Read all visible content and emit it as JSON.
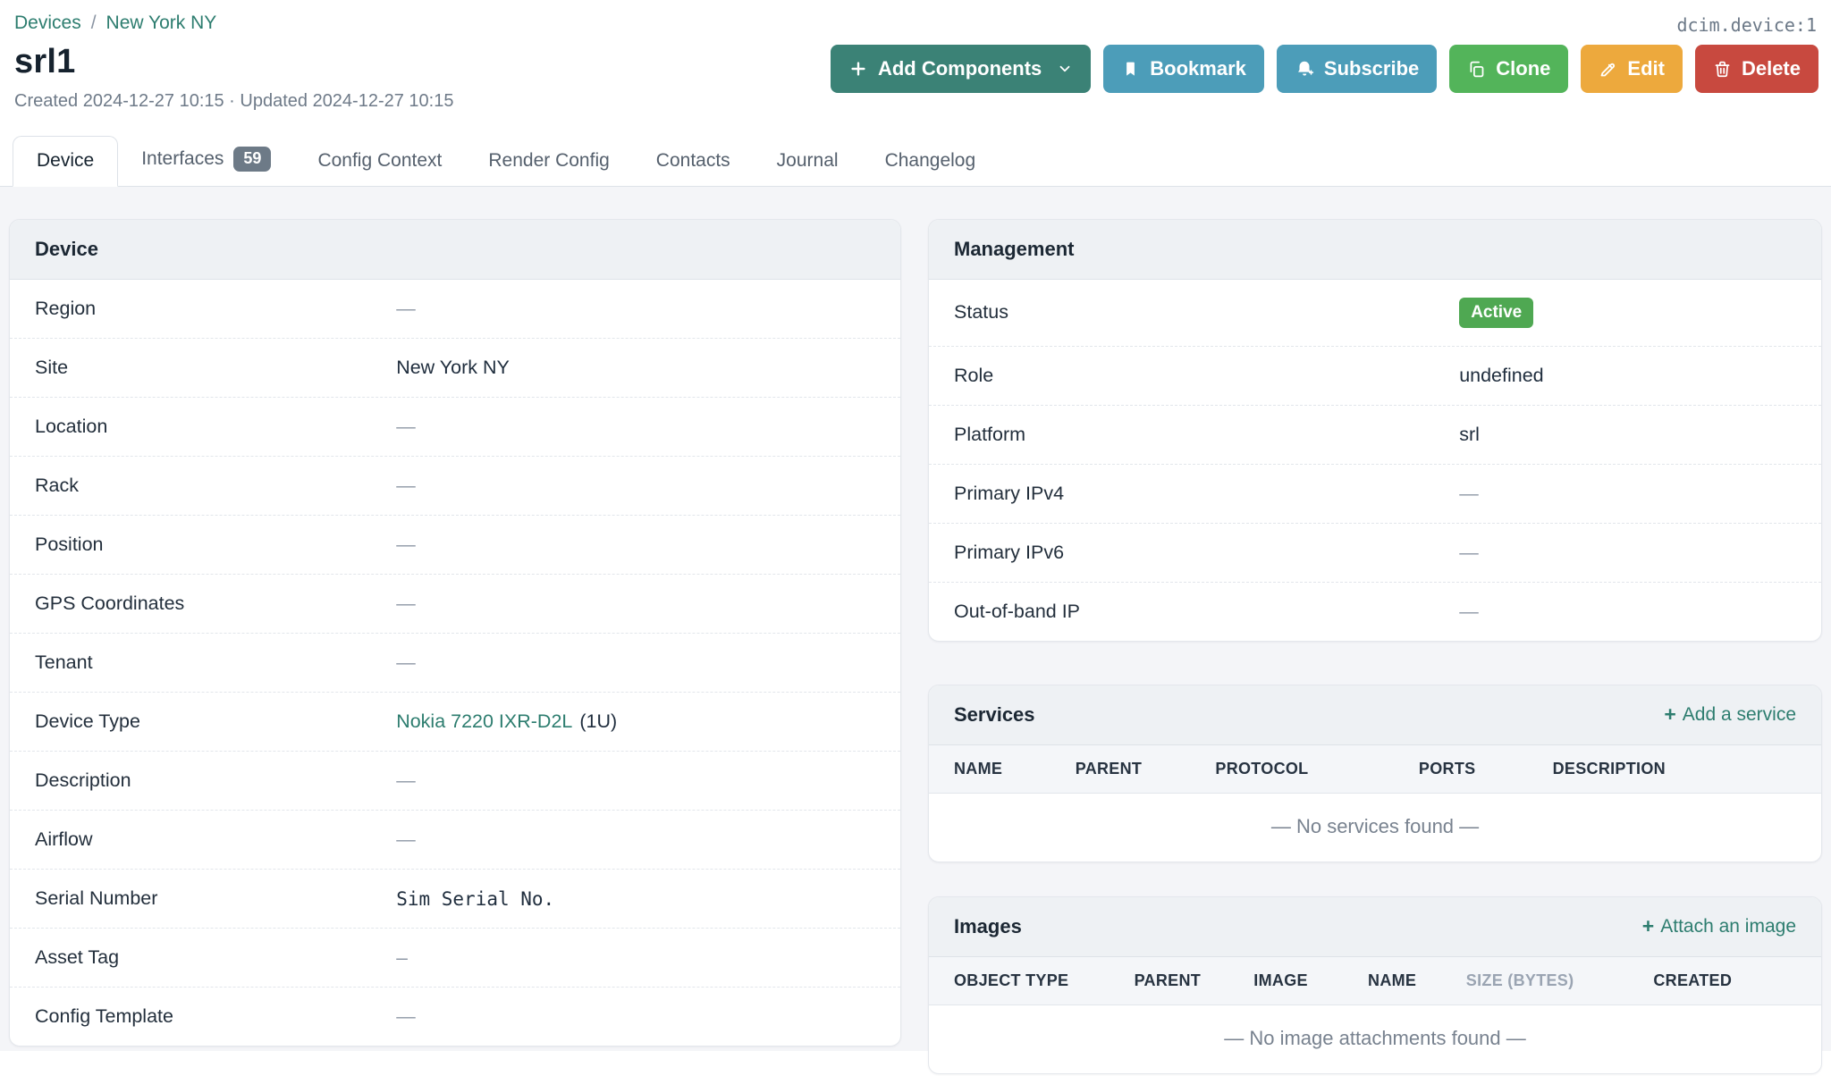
{
  "breadcrumb": {
    "devices": "Devices",
    "separator": "/",
    "site": "New York NY"
  },
  "object_id": "dcim.device:1",
  "header": {
    "title": "srl1",
    "meta": "Created 2024-12-27 10:15 · Updated 2024-12-27 10:15"
  },
  "actions": {
    "add_components": "Add Components",
    "bookmark": "Bookmark",
    "subscribe": "Subscribe",
    "clone": "Clone",
    "edit": "Edit",
    "delete": "Delete"
  },
  "tabs": [
    {
      "label": "Device",
      "active": true
    },
    {
      "label": "Interfaces",
      "badge": "59"
    },
    {
      "label": "Config Context"
    },
    {
      "label": "Render Config"
    },
    {
      "label": "Contacts"
    },
    {
      "label": "Journal"
    },
    {
      "label": "Changelog"
    }
  ],
  "icons": {
    "plus": "+"
  },
  "device_panel": {
    "title": "Device",
    "rows": [
      {
        "label": "Region",
        "value": "—",
        "type": "empty"
      },
      {
        "label": "Site",
        "value": "New York NY",
        "type": "link"
      },
      {
        "label": "Location",
        "value": "—",
        "type": "empty"
      },
      {
        "label": "Rack",
        "value": "—",
        "type": "empty"
      },
      {
        "label": "Position",
        "value": "—",
        "type": "empty"
      },
      {
        "label": "GPS Coordinates",
        "value": "—",
        "type": "empty"
      },
      {
        "label": "Tenant",
        "value": "—",
        "type": "empty"
      },
      {
        "label": "Device Type",
        "value": "Nokia 7220 IXR-D2L",
        "suffix": "(1U)",
        "type": "link"
      },
      {
        "label": "Description",
        "value": "—",
        "type": "empty"
      },
      {
        "label": "Airflow",
        "value": "—",
        "type": "empty"
      },
      {
        "label": "Serial Number",
        "value": "Sim Serial No.",
        "type": "mono"
      },
      {
        "label": "Asset Tag",
        "value": "–",
        "type": "mono-empty"
      },
      {
        "label": "Config Template",
        "value": "—",
        "type": "empty"
      }
    ]
  },
  "management_panel": {
    "title": "Management",
    "rows": [
      {
        "label": "Status",
        "value": "Active",
        "type": "badge"
      },
      {
        "label": "Role",
        "value": "undefined",
        "type": "link"
      },
      {
        "label": "Platform",
        "value": "srl",
        "type": "link"
      },
      {
        "label": "Primary IPv4",
        "value": "—",
        "type": "empty"
      },
      {
        "label": "Primary IPv6",
        "value": "—",
        "type": "empty"
      },
      {
        "label": "Out-of-band IP",
        "value": "—",
        "type": "empty"
      }
    ]
  },
  "services_panel": {
    "title": "Services",
    "action_label": "Add a service",
    "columns": [
      "NAME",
      "PARENT",
      "PROTOCOL",
      "PORTS",
      "DESCRIPTION"
    ],
    "empty_message": "— No services found —"
  },
  "images_panel": {
    "title": "Images",
    "action_label": "Attach an image",
    "columns": [
      "OBJECT TYPE",
      "PARENT",
      "IMAGE",
      "NAME",
      "SIZE (BYTES)",
      "CREATED"
    ],
    "empty_message": "— No image attachments found —"
  },
  "colors": {
    "link": "#2d7d6f",
    "btn_primary": "#3b8276",
    "btn_info": "#4c9db9",
    "btn_success": "#53b45a",
    "btn_warning": "#eda93d",
    "btn_danger": "#c8493f",
    "badge_active": "#4fa852",
    "badge_count": "#6d7a87"
  }
}
